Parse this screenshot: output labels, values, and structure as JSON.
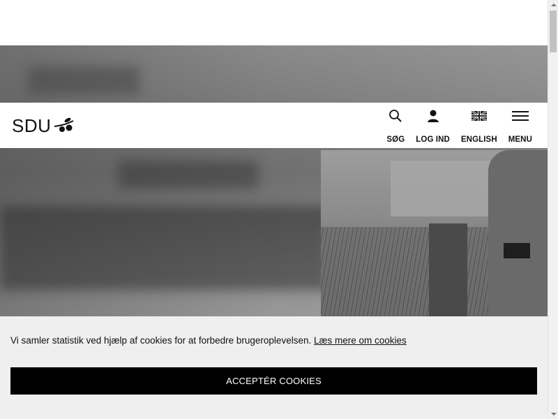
{
  "header": {
    "logo_text": "SDU",
    "nav": [
      {
        "label": "SØG",
        "icon": "search-icon"
      },
      {
        "label": "LOG IND",
        "icon": "user-icon"
      },
      {
        "label": "ENGLISH",
        "icon": "uk-flag-icon"
      },
      {
        "label": "MENU",
        "icon": "hamburger-menu-icon"
      }
    ]
  },
  "cookie_banner": {
    "message": "Vi samler statistik ved hjælp af cookies for at forbedre brugeroplevelsen.",
    "link_text": "Læs mere om cookies",
    "accept_label": "ACCEPTÉR COOKIES",
    "background": "#efefef",
    "button_color": "#000000"
  },
  "colors": {
    "header_bg": "#ffffff",
    "text": "#111111"
  }
}
